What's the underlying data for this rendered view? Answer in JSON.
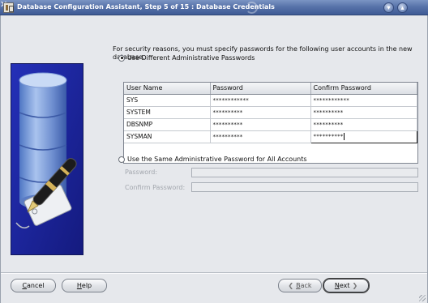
{
  "window": {
    "title": "Database Configuration Assistant, Step 5 of 15 : Database Credentials",
    "minimize_glyph": "▾",
    "maximize_glyph": "▴",
    "close_glyph": "✕"
  },
  "intro_text": "For security reasons, you must specify passwords for the following user accounts in the new database.",
  "option_different": {
    "label": "Use Different Administrative Passwords",
    "selected": true
  },
  "table": {
    "columns": [
      "User Name",
      "Password",
      "Confirm Password"
    ],
    "rows": [
      {
        "user": "SYS",
        "password": "************",
        "confirm": "************"
      },
      {
        "user": "SYSTEM",
        "password": "**********",
        "confirm": "**********"
      },
      {
        "user": "DBSNMP",
        "password": "**********",
        "confirm": "**********"
      },
      {
        "user": "SYSMAN",
        "password": "**********",
        "confirm": "**********"
      }
    ]
  },
  "option_same": {
    "label": "Use the Same Administrative Password for All Accounts",
    "selected": false,
    "password_label": "Password:",
    "confirm_label": "Confirm Password:",
    "password_value": "",
    "confirm_value": ""
  },
  "buttons": {
    "cancel": "Cancel",
    "help": "Help",
    "back": "Back",
    "next": "Next",
    "back_arrow": "❮",
    "next_arrow": "❯"
  }
}
